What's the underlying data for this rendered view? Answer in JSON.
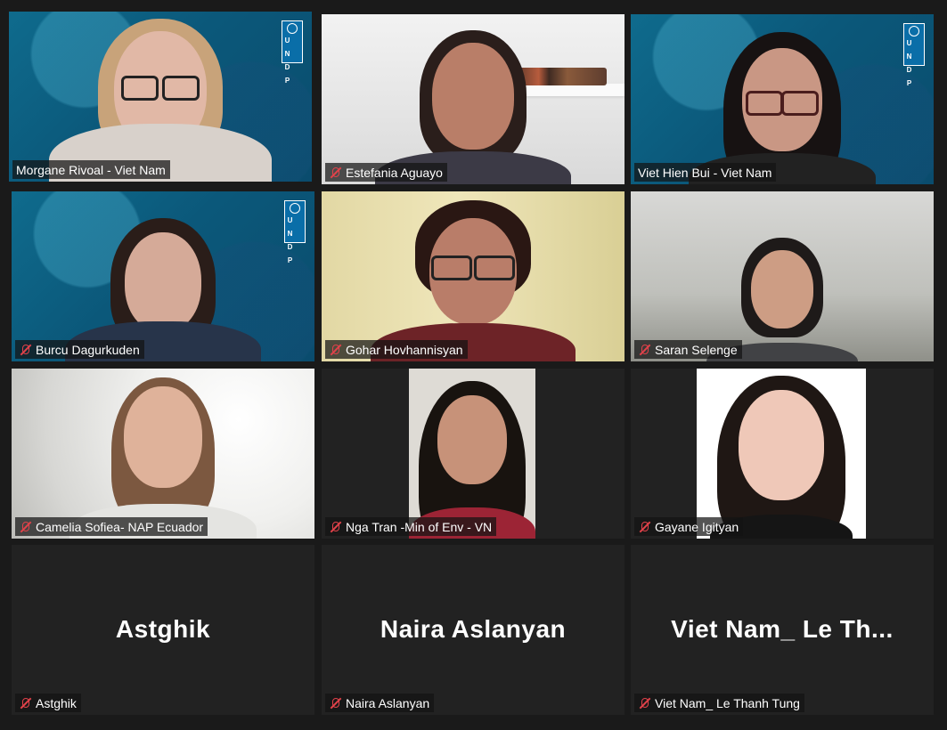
{
  "participants": [
    {
      "name": "Morgane Rivoal - Viet Nam",
      "muted": false,
      "active": true,
      "undp_logo": true,
      "logo_text": "U N D P"
    },
    {
      "name": "Estefania Aguayo",
      "muted": true,
      "active": false,
      "undp_logo": false
    },
    {
      "name": "Viet Hien Bui - Viet Nam",
      "muted": false,
      "active": false,
      "undp_logo": true,
      "logo_text": "U N D P"
    },
    {
      "name": "Burcu Dagurkuden",
      "muted": true,
      "active": false,
      "undp_logo": true,
      "logo_text": "U N D P"
    },
    {
      "name": "Gohar Hovhannisyan",
      "muted": true,
      "active": false,
      "undp_logo": false
    },
    {
      "name": "Saran Selenge",
      "muted": true,
      "active": false,
      "undp_logo": false
    },
    {
      "name": "Camelia Sofiea- NAP Ecuador",
      "muted": true,
      "active": false,
      "undp_logo": false
    },
    {
      "name": "Nga Tran -Min of Env - VN",
      "muted": true,
      "active": false,
      "undp_logo": false
    },
    {
      "name": "Gayane Igityan",
      "muted": true,
      "active": false,
      "undp_logo": false
    },
    {
      "name": "Astghik",
      "muted": true,
      "active": false,
      "display_label": "Astghik",
      "video_off": true
    },
    {
      "name": "Naira Aslanyan",
      "muted": true,
      "active": false,
      "display_label": "Naira Aslanyan",
      "video_off": true
    },
    {
      "name": "Viet Nam_ Le Thanh Tung",
      "muted": true,
      "active": false,
      "display_label": "Viet Nam_ Le Th...",
      "video_off": true
    }
  ],
  "colors": {
    "active_border": "#c9e76d",
    "muted_icon": "#e2424a",
    "background": "#1a1a1a"
  }
}
